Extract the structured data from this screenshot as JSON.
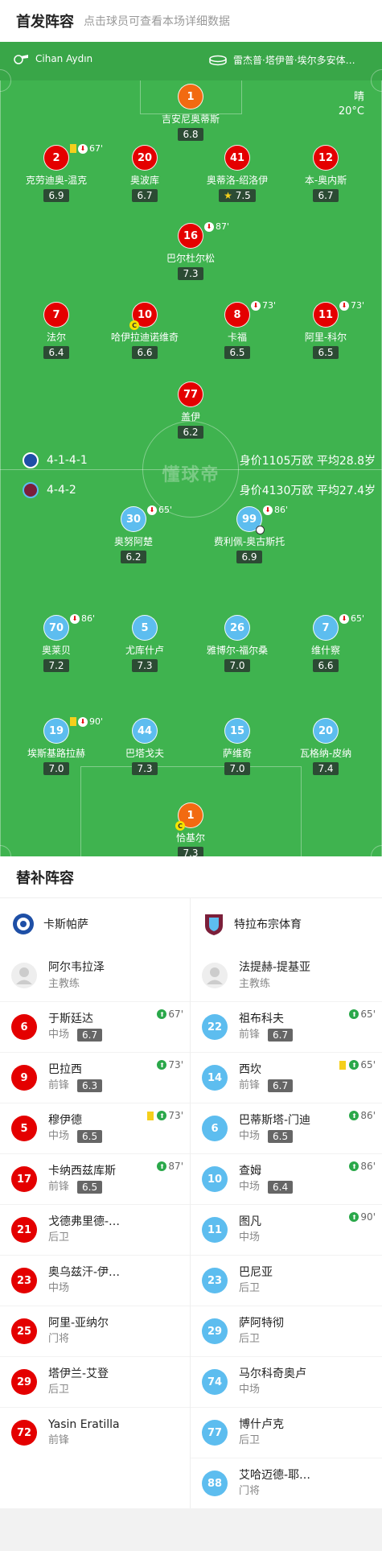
{
  "header": {
    "title": "首发阵容",
    "subtitle": "点击球员可查看本场详细数据"
  },
  "referees": {
    "main": "Cihan Aydın",
    "assistants": "雷杰普·塔伊普·埃尔多安体…"
  },
  "weather": {
    "condition": "晴",
    "temperature": "20°C"
  },
  "watermark": "懂球帝",
  "home_team": {
    "formation": "4-1-4-1",
    "value": "身价1105万欧 平均28.8岁"
  },
  "away_team": {
    "formation": "4-4-2",
    "value": "身价4130万欧 平均27.4岁"
  },
  "home_players": [
    {
      "number": "1",
      "name": "吉安尼奥蒂斯",
      "rating": "6.8",
      "color": "orange"
    },
    {
      "number": "2",
      "name": "克劳迪奥-温克",
      "rating": "6.9",
      "event": "67'",
      "yellow": true,
      "sub": true
    },
    {
      "number": "20",
      "name": "奥波库",
      "rating": "6.7"
    },
    {
      "number": "41",
      "name": "奥蒂洛-绍洛伊",
      "rating": "7.5",
      "star": true
    },
    {
      "number": "12",
      "name": "本-奥内斯",
      "rating": "6.7"
    },
    {
      "number": "16",
      "name": "巴尔杜尔松",
      "rating": "7.3",
      "event": "87'",
      "sub": true
    },
    {
      "number": "7",
      "name": "法尔",
      "rating": "6.4"
    },
    {
      "number": "10",
      "name": "哈伊拉迪诺维奇",
      "rating": "6.6",
      "captain": true
    },
    {
      "number": "8",
      "name": "卡福",
      "rating": "6.5",
      "event": "73'",
      "sub": true
    },
    {
      "number": "11",
      "name": "阿里-科尔",
      "rating": "6.5",
      "event": "73'",
      "sub": true
    },
    {
      "number": "77",
      "name": "盖伊",
      "rating": "6.2"
    }
  ],
  "away_players": [
    {
      "number": "30",
      "name": "奥努阿楚",
      "rating": "6.2",
      "event": "65'",
      "sub": true
    },
    {
      "number": "99",
      "name": "费利佩-奥古斯托",
      "rating": "6.9",
      "event": "86'",
      "sub": true,
      "goal": true
    },
    {
      "number": "70",
      "name": "奥莱贝",
      "rating": "7.2",
      "event": "86'",
      "sub": true
    },
    {
      "number": "5",
      "name": "尤库什卢",
      "rating": "7.3"
    },
    {
      "number": "26",
      "name": "雅博尔-福尔桑",
      "rating": "7.0"
    },
    {
      "number": "7",
      "name": "维什察",
      "rating": "6.6",
      "event": "65'",
      "sub": true
    },
    {
      "number": "19",
      "name": "埃斯基路拉赫",
      "rating": "7.0",
      "event": "90'",
      "yellow": true,
      "sub": true
    },
    {
      "number": "44",
      "name": "巴塔戈夫",
      "rating": "7.3"
    },
    {
      "number": "15",
      "name": "萨维奇",
      "rating": "7.0"
    },
    {
      "number": "20",
      "name": "瓦格纳-皮纳",
      "rating": "7.4"
    },
    {
      "number": "1",
      "name": "恰基尔",
      "rating": "7.3",
      "color": "orange",
      "captain": true
    }
  ],
  "subs": {
    "title": "替补阵容",
    "home": {
      "team": "卡斯帕萨",
      "coach": "阿尔韦拉泽",
      "coach_role": "主教练",
      "players": [
        {
          "number": "6",
          "name": "于斯廷达",
          "pos": "中场",
          "rating": "6.7",
          "event": "67'"
        },
        {
          "number": "9",
          "name": "巴拉西",
          "pos": "前锋",
          "rating": "6.3",
          "event": "73'"
        },
        {
          "number": "5",
          "name": "穆伊德",
          "pos": "中场",
          "rating": "6.5",
          "event": "73'",
          "yellow": true
        },
        {
          "number": "17",
          "name": "卡纳西兹库斯",
          "pos": "前锋",
          "rating": "6.5",
          "event": "87'"
        },
        {
          "number": "21",
          "name": "戈德弗里德-…",
          "pos": "后卫"
        },
        {
          "number": "23",
          "name": "奥乌兹汗-伊…",
          "pos": "中场"
        },
        {
          "number": "25",
          "name": "阿里-亚纳尔",
          "pos": "门将"
        },
        {
          "number": "29",
          "name": "塔伊兰-艾登",
          "pos": "后卫"
        },
        {
          "number": "72",
          "name": "Yasin Eratilla",
          "pos": "前锋"
        }
      ]
    },
    "away": {
      "team": "特拉布宗体育",
      "coach": "法提赫-提基亚",
      "coach_role": "主教练",
      "players": [
        {
          "number": "22",
          "name": "祖布科夫",
          "pos": "前锋",
          "rating": "6.7",
          "event": "65'"
        },
        {
          "number": "14",
          "name": "西坎",
          "pos": "前锋",
          "rating": "6.7",
          "event": "65'",
          "yellow": true
        },
        {
          "number": "6",
          "name": "巴蒂斯塔-门迪",
          "pos": "中场",
          "rating": "6.5",
          "event": "86'"
        },
        {
          "number": "10",
          "name": "查姆",
          "pos": "中场",
          "rating": "6.4",
          "event": "86'"
        },
        {
          "number": "11",
          "name": "图凡",
          "pos": "中场",
          "event": "90'"
        },
        {
          "number": "23",
          "name": "巴尼亚",
          "pos": "后卫"
        },
        {
          "number": "29",
          "name": "萨阿特彻",
          "pos": "后卫"
        },
        {
          "number": "74",
          "name": "马尔科奇奥卢",
          "pos": "中场"
        },
        {
          "number": "77",
          "name": "博什卢克",
          "pos": "后卫"
        },
        {
          "number": "88",
          "name": "艾哈迈德-耶…",
          "pos": "门将"
        }
      ]
    }
  },
  "colors": {
    "pitch": "#3fb34f",
    "home": "#e40000",
    "away": "#5dbdef",
    "keeper": "#f26a11"
  }
}
